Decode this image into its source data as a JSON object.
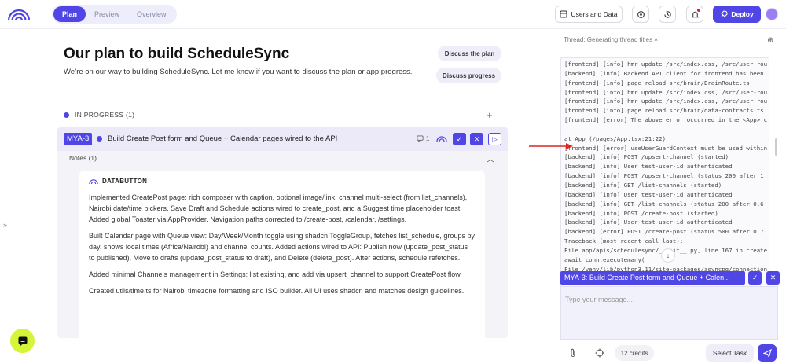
{
  "nav": {
    "tabs": [
      {
        "label": "Plan",
        "active": true
      },
      {
        "label": "Preview",
        "active": false
      },
      {
        "label": "Overview",
        "active": false
      }
    ],
    "users_and_data": "Users and Data",
    "deploy": "Deploy"
  },
  "plan": {
    "title": "Our plan to build ScheduleSync",
    "subtitle": "We’re on our way to building ScheduleSync. Let me know if you want to discuss the plan or app progress.",
    "discuss_plan": "Discuss the plan",
    "discuss_progress": "Discuss progress",
    "section_label": "IN PROGRESS (1)"
  },
  "task": {
    "id": "MYA-3",
    "title": "Build Create Post form and Queue + Calendar pages wired to the API",
    "comment_count": "1",
    "notes_label": "Notes (1)",
    "note_author": "DATABUTTON",
    "note_paragraphs": [
      "Implemented CreatePost page: rich composer with caption, optional image/link, channel multi-select (from list_channels), Nairobi date/time pickers, Save Draft and Schedule actions wired to create_post, and a Suggest time placeholder toast. Added global Toaster via AppProvider. Navigation paths corrected to /create-post, /calendar, /settings.",
      "Built Calendar page with Queue view: Day/Week/Month toggle using shadcn ToggleGroup, fetches list_schedule, groups by day, shows local times (Africa/Nairobi) and channel counts. Added actions wired to API: Publish now (update_post_status to published), Move to drafts (update_post_status to draft), and Delete (delete_post). After actions, schedule refetches.",
      "Added minimal Channels management in Settings: list existing, and add via upsert_channel to support CreatePost flow.",
      "Created utils/time.ts for Nairobi timezone formatting and ISO builder. All UI uses shadcn and matches design guidelines."
    ]
  },
  "thread": {
    "title": "Thread: Generating thread titles",
    "log_lines": [
      "[frontend] [info] hmr update /src/index.css, /src/user-rou",
      "[backend] [info] Backend API client for frontend has been",
      "[frontend] [info] page reload src/brain/BrainRoute.ts",
      "[frontend] [info] hmr update /src/index.css, /src/user-rou",
      "[frontend] [info] hmr update /src/index.css, /src/user-rou",
      "[frontend] [info] page reload src/brain/data-contracts.ts",
      "[frontend] [error] The above error occurred in the <App> c",
      "",
      "    at App (/pages/App.tsx:21:22)",
      "[frontend] [error] useUserGuardContext must be used within",
      "[backend] [info] POST /upsert-channel (started)",
      "[backend] [info] User test-user-id authenticated",
      "[backend] [info] POST /upsert-channel (status 200 after 1",
      "[backend] [info] GET /list-channels (started)",
      "[backend] [info] User test-user-id authenticated",
      "[backend] [info] GET /list-channels (status 200 after 0.6",
      "[backend] [info] POST /create-post (started)",
      "[backend] [info] User test-user-id authenticated",
      "[backend] [error] POST /create-post (status 500 after 0.7",
      "Traceback (most recent call last):",
      "File app/apis/schedulesync/__init__.py, line 167 in create",
      "  await conn.executemany(",
      "File /venv/lib/python3.11/site-packages/asyncpg/connection"
    ],
    "task_chip": "MYA-3: Build Create Post form and Queue + Calen...",
    "message_placeholder": "Type your message...",
    "credits": "12 credits",
    "select_task": "Select Task"
  },
  "colors": {
    "accent": "#4f46e5",
    "annotation_arrow": "#e02424",
    "chat_fab": "#d4f538"
  }
}
